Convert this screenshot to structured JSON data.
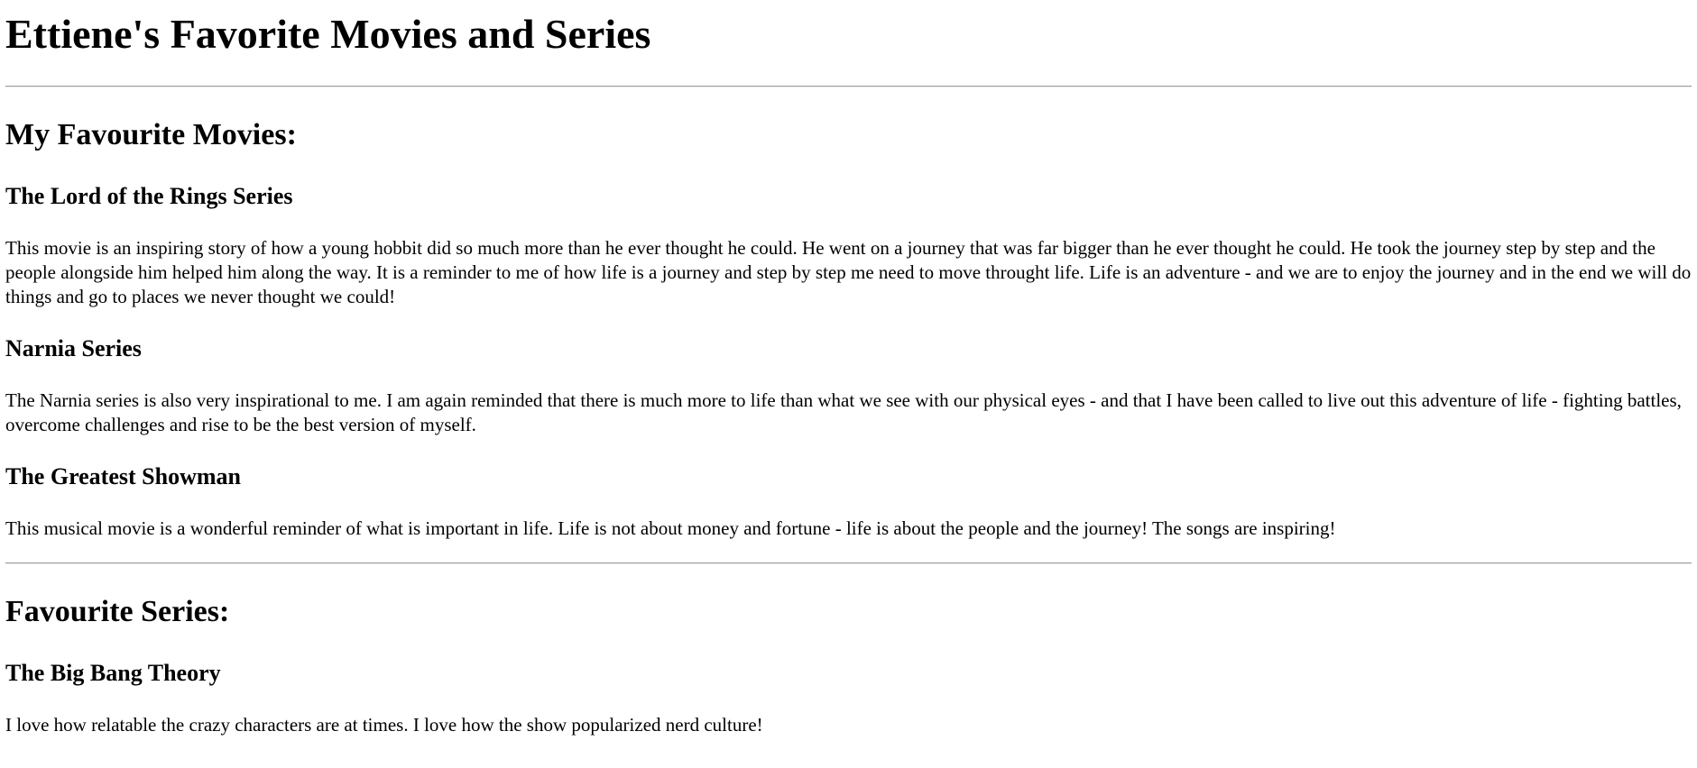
{
  "page": {
    "title": "Ettiene's Favorite Movies and Series"
  },
  "movies": {
    "heading": "My Favourite Movies:",
    "items": [
      {
        "title": "The Lord of the Rings Series",
        "description": "This movie is an inspiring story of how a young hobbit did so much more than he ever thought he could. He went on a journey that was far bigger than he ever thought he could. He took the journey step by step and the people alongside him helped him along the way. It is a reminder to me of how life is a journey and step by step me need to move throught life. Life is an adventure - and we are to enjoy the journey and in the end we will do things and go to places we never thought we could!"
      },
      {
        "title": "Narnia Series",
        "description": "The Narnia series is also very inspirational to me. I am again reminded that there is much more to life than what we see with our physical eyes - and that I have been called to live out this adventure of life - fighting battles, overcome challenges and rise to be the best version of myself."
      },
      {
        "title": "The Greatest Showman",
        "description": "This musical movie is a wonderful reminder of what is important in life. Life is not about money and fortune - life is about the people and the journey! The songs are inspiring!"
      }
    ]
  },
  "series": {
    "heading": "Favourite Series:",
    "items": [
      {
        "title": "The Big Bang Theory",
        "description": "I love how relatable the crazy characters are at times. I love how the show popularized nerd culture!"
      }
    ]
  }
}
